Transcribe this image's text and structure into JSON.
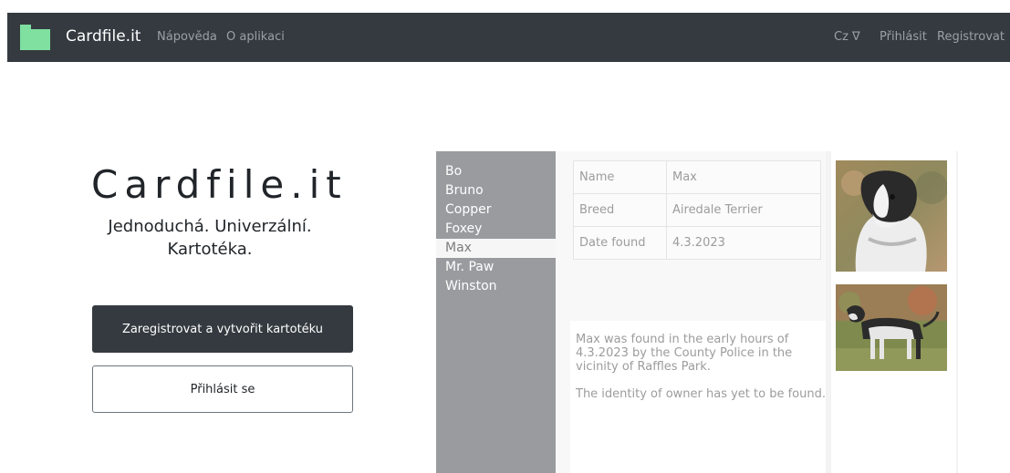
{
  "navbar": {
    "brand": "Cardfile.it",
    "links": [
      "Nápověda",
      "O aplikaci"
    ],
    "language": "Cz ∇",
    "login": "Přihlásit",
    "register": "Registrovat",
    "logo_icon": "folder-icon"
  },
  "hero": {
    "title": "Cardfile.it",
    "subtitle_line1": "Jednoduchá. Univerzální.",
    "subtitle_line2": "Kartotéka.",
    "register_button": "Zaregistrovat a vytvořit kartotéku",
    "login_button": "Přihlásit se"
  },
  "preview": {
    "list": [
      "Bo",
      "Bruno",
      "Copper",
      "Foxey",
      "Max",
      "Mr. Paw",
      "Winston"
    ],
    "selected": "Max",
    "fields": [
      {
        "label": "Name",
        "value": "Max"
      },
      {
        "label": "Breed",
        "value": "Airedale Terrier"
      },
      {
        "label": "Date found",
        "value": "4.3.2023"
      }
    ],
    "description": [
      "Max was found in the early hours of 4.3.2023 by the County Police in the vicinity of Raffles Park.",
      "The identity of owner has yet to be found."
    ]
  },
  "colors": {
    "navbar": "#343a40",
    "logo": "#7fe0a0",
    "list_bg": "#9a9b9f"
  }
}
